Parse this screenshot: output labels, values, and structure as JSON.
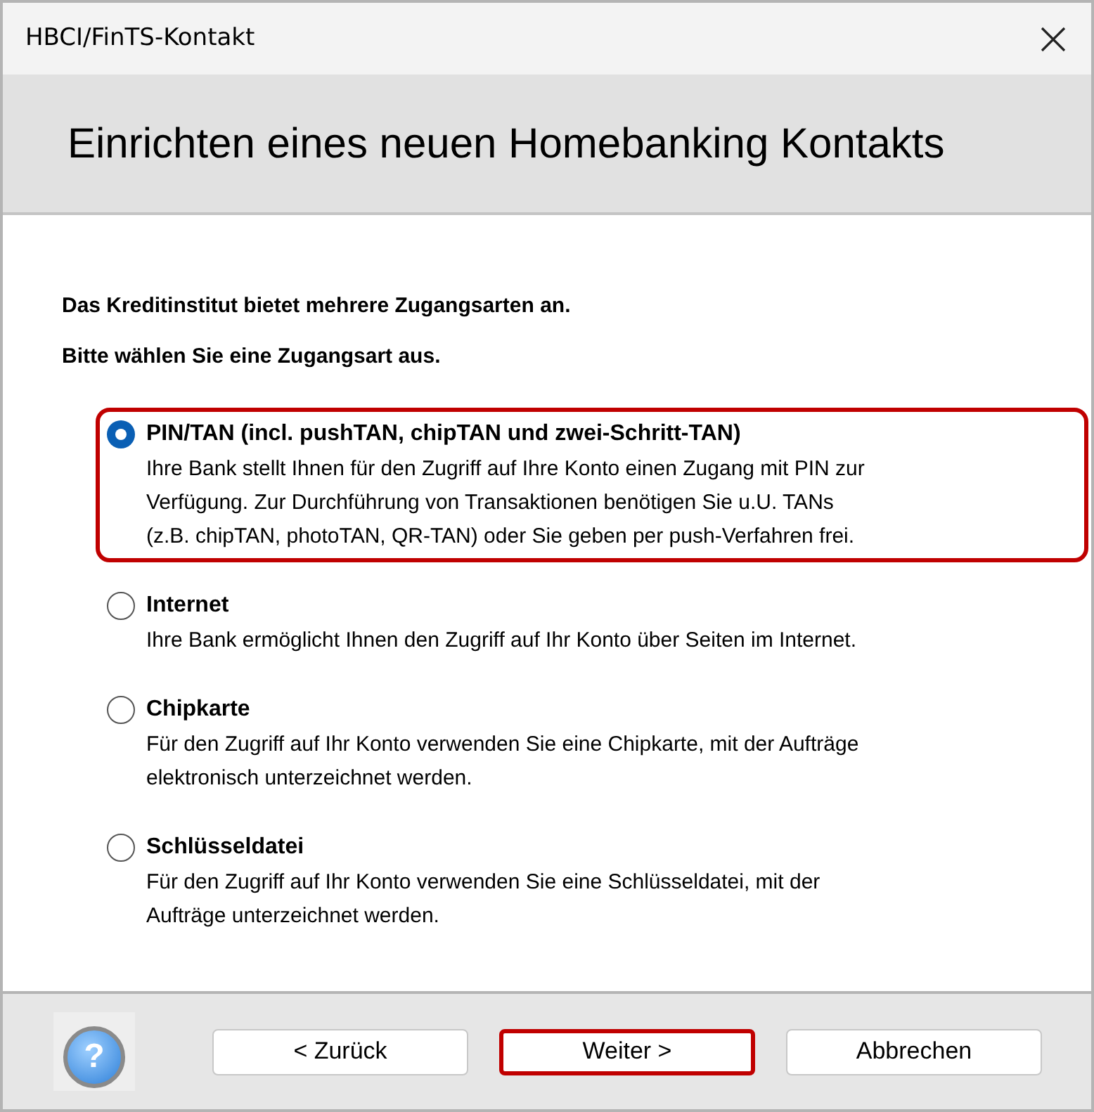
{
  "window": {
    "title": "HBCI/FinTS-Kontakt"
  },
  "header": {
    "title": "Einrichten eines neuen Homebanking Kontakts"
  },
  "intro": [
    "Das Kreditinstitut bietet mehrere Zugangsarten an.",
    "Bitte wählen Sie eine Zugangsart aus."
  ],
  "options": [
    {
      "label": "PIN/TAN (incl. pushTAN, chipTAN und zwei-Schritt-TAN)",
      "description": [
        "Ihre Bank stellt Ihnen für den Zugriff auf Ihre Konto einen Zugang mit PIN zur",
        "Verfügung. Zur Durchführung von Transaktionen benötigen Sie u.U. TANs",
        "(z.B. chipTAN, photoTAN, QR-TAN) oder Sie geben per push-Verfahren frei."
      ],
      "selected": true,
      "highlighted": true
    },
    {
      "label": "Internet",
      "description": [
        "Ihre Bank ermöglicht Ihnen den Zugriff auf Ihr Konto über Seiten im Internet."
      ],
      "selected": false,
      "highlighted": false
    },
    {
      "label": "Chipkarte",
      "description": [
        "Für den Zugriff auf Ihr Konto verwenden Sie eine Chipkarte, mit der Aufträge",
        "elektronisch unterzeichnet werden."
      ],
      "selected": false,
      "highlighted": false
    },
    {
      "label": "Schlüsseldatei",
      "description": [
        "Für den Zugriff auf Ihr Konto verwenden Sie eine Schlüsseldatei, mit der",
        "Aufträge unterzeichnet werden."
      ],
      "selected": false,
      "highlighted": false
    }
  ],
  "footer": {
    "help": "?",
    "buttons": [
      {
        "label": "< Zurück",
        "highlighted": false
      },
      {
        "label": "Weiter >",
        "highlighted": true
      },
      {
        "label": "Abbrechen",
        "highlighted": false
      }
    ]
  }
}
